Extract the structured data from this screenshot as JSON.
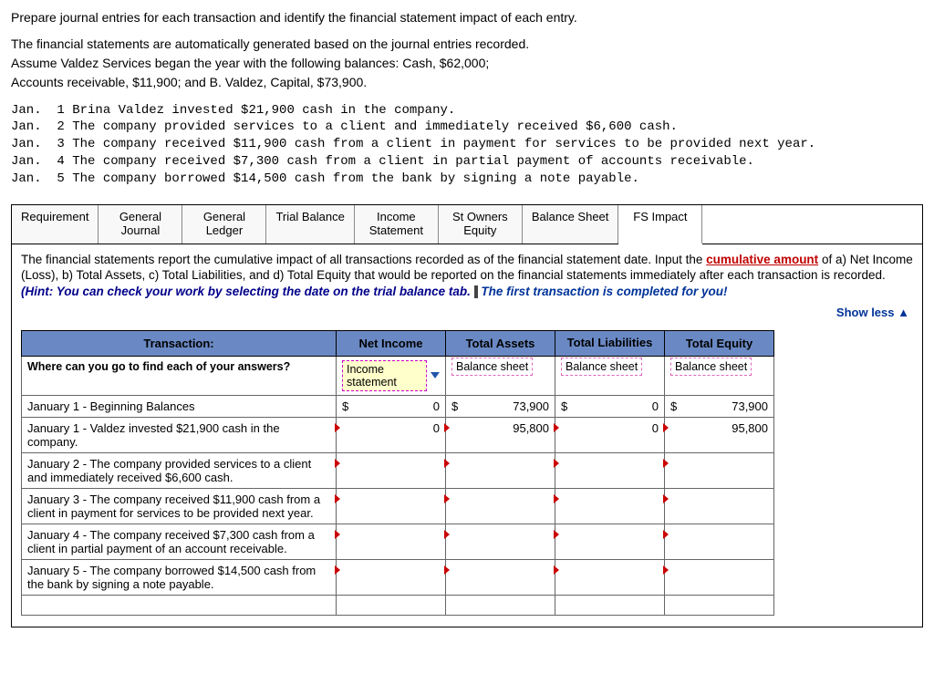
{
  "intro": {
    "line1": "Prepare journal entries for each transaction and identify the financial statement impact of each entry.",
    "line2": "The financial statements are automatically generated based on the journal entries recorded.",
    "line3": "Assume Valdez Services began the year with the following balances:  Cash, $62,000;",
    "line4": "Accounts receivable, $11,900; and B. Valdez, Capital, $73,900."
  },
  "mono": "Jan.  1 Brina Valdez invested $21,900 cash in the company.\nJan.  2 The company provided services to a client and immediately received $6,600 cash.\nJan.  3 The company received $11,900 cash from a client in payment for services to be provided next year.\nJan.  4 The company received $7,300 cash from a client in partial payment of accounts receivable.\nJan.  5 The company borrowed $14,500 cash from the bank by signing a note payable.",
  "tabs": {
    "requirement": "Requirement",
    "gj": "General\nJournal",
    "gl": "General\nLedger",
    "tb": "Trial Balance",
    "is": "Income\nStatement",
    "soe": "St Owners\nEquity",
    "bs": "Balance Sheet",
    "fsi": "FS Impact"
  },
  "instr": {
    "p1a": "The financial statements report the cumulative impact of all transactions recorded as of the financial statement date.   Input the ",
    "cumulative": "cumulative amount",
    "p1b": " of a) Net Income (Loss), b)  Total Assets, c) Total Liabilities, and d)  Total Equity that would be reported on the financial statements immediately after each transaction is recorded.  ",
    "hint": "(Hint:  You can check your work by selecting the date on the trial balance tab.",
    "p1c": " The first transaction is completed for you!",
    "showless": "Show less",
    "arrow": "▲"
  },
  "headers": {
    "transaction": "Transaction:",
    "netincome": "Net Income",
    "totalassets": "Total Assets",
    "totalliab": "Total Liabilities",
    "totaleq": "Total Equity"
  },
  "hintrow": {
    "q": "Where can you go to find each of your answers?",
    "ni": "Income statement",
    "ta": "Balance sheet",
    "tl": "Balance sheet",
    "te": "Balance sheet"
  },
  "rows": [
    {
      "label": "January 1 -  Beginning Balances",
      "ni_sym": "$",
      "ni_val": "0",
      "ta_sym": "$",
      "ta_val": "73,900",
      "tl_sym": "$",
      "tl_val": "0",
      "te_sym": "$",
      "te_val": "73,900",
      "marker": false
    },
    {
      "label": "January 1 -  Valdez invested $21,900 cash in the company.",
      "ni_sym": "",
      "ni_val": "0",
      "ta_sym": "",
      "ta_val": "95,800",
      "tl_sym": "",
      "tl_val": "0",
      "te_sym": "",
      "te_val": "95,800",
      "marker": true
    },
    {
      "label": "January 2 - The company provided services to a client and immediately received $6,600 cash.",
      "ni_sym": "",
      "ni_val": "",
      "ta_sym": "",
      "ta_val": "",
      "tl_sym": "",
      "tl_val": "",
      "te_sym": "",
      "te_val": "",
      "marker": true
    },
    {
      "label": "January 3 - The company received $11,900 cash from a client in payment for services to be provided next year.",
      "ni_sym": "",
      "ni_val": "",
      "ta_sym": "",
      "ta_val": "",
      "tl_sym": "",
      "tl_val": "",
      "te_sym": "",
      "te_val": "",
      "marker": true
    },
    {
      "label": "January 4 - The company received $7,300 cash from a client in partial payment of an account receivable.",
      "ni_sym": "",
      "ni_val": "",
      "ta_sym": "",
      "ta_val": "",
      "tl_sym": "",
      "tl_val": "",
      "te_sym": "",
      "te_val": "",
      "marker": true
    },
    {
      "label": "January 5 - The company borrowed $14,500 cash from the bank by signing a note payable.",
      "ni_sym": "",
      "ni_val": "",
      "ta_sym": "",
      "ta_val": "",
      "tl_sym": "",
      "tl_val": "",
      "te_sym": "",
      "te_val": "",
      "marker": true
    }
  ]
}
